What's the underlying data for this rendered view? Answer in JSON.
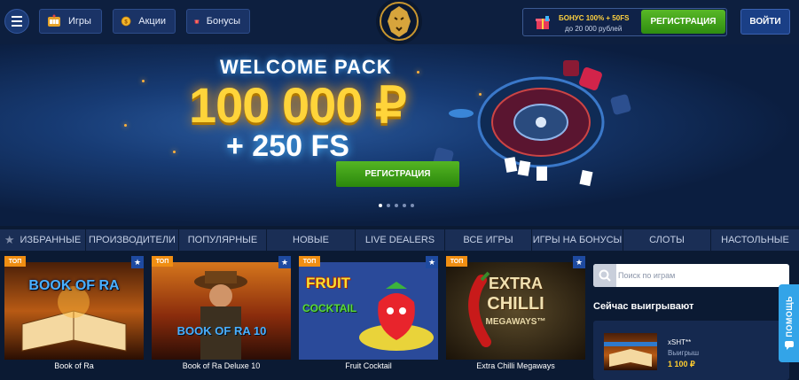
{
  "header": {
    "nav": [
      {
        "label": "Игры",
        "icon": "slot-machine-icon"
      },
      {
        "label": "Акции",
        "icon": "coin-icon"
      },
      {
        "label": "Бонусы",
        "icon": "gift-icon"
      }
    ],
    "bonus_line1": "БОНУС 100% + 50FS",
    "bonus_line2": "до 20 000 рублей",
    "register_label": "РЕГИСТРАЦИЯ",
    "login_label": "ВОЙТИ"
  },
  "hero": {
    "title": "WELCOME PACK",
    "amount": "100 000 ₽",
    "free_spins": "+ 250 FS",
    "register_label": "РЕГИСТРАЦИЯ",
    "slides_total": 5,
    "active_slide": 1
  },
  "categories": [
    {
      "label": "Избранные"
    },
    {
      "label": "Производители"
    },
    {
      "label": "Популярные"
    },
    {
      "label": "Новые"
    },
    {
      "label": "Live Dealers"
    },
    {
      "label": "Все игры"
    },
    {
      "label": "Игры на бонусы"
    },
    {
      "label": "Слоты"
    },
    {
      "label": "Настольные"
    }
  ],
  "games": [
    {
      "title": "Book of Ra",
      "tag": "ТОП",
      "art": "BOOK OF RA"
    },
    {
      "title": "Book of Ra Deluxe 10",
      "tag": "ТОП",
      "art": "BOOK OF RA 10"
    },
    {
      "title": "Fruit Cocktail",
      "tag": "ТОП",
      "art_line1": "FRUIT",
      "art_line2": "COCKTAIL"
    },
    {
      "title": "Extra Chilli Megaways",
      "tag": "ТОП",
      "art_line1": "EXTRA",
      "art_line2": "CHILLI",
      "art_line3": "MEGAWAYS™"
    }
  ],
  "search": {
    "placeholder": "Поиск по играм"
  },
  "winners": {
    "title": "Сейчас выигрывают",
    "items": [
      {
        "user": "xSHT**",
        "game": "Выигрыш",
        "amount": "1 100 ₽"
      }
    ]
  },
  "help_label": "ПОМОЩЬ",
  "colors": {
    "accent_green": "#3a9a16",
    "accent_gold": "#ffd43a",
    "bg": "#0b1a33"
  }
}
